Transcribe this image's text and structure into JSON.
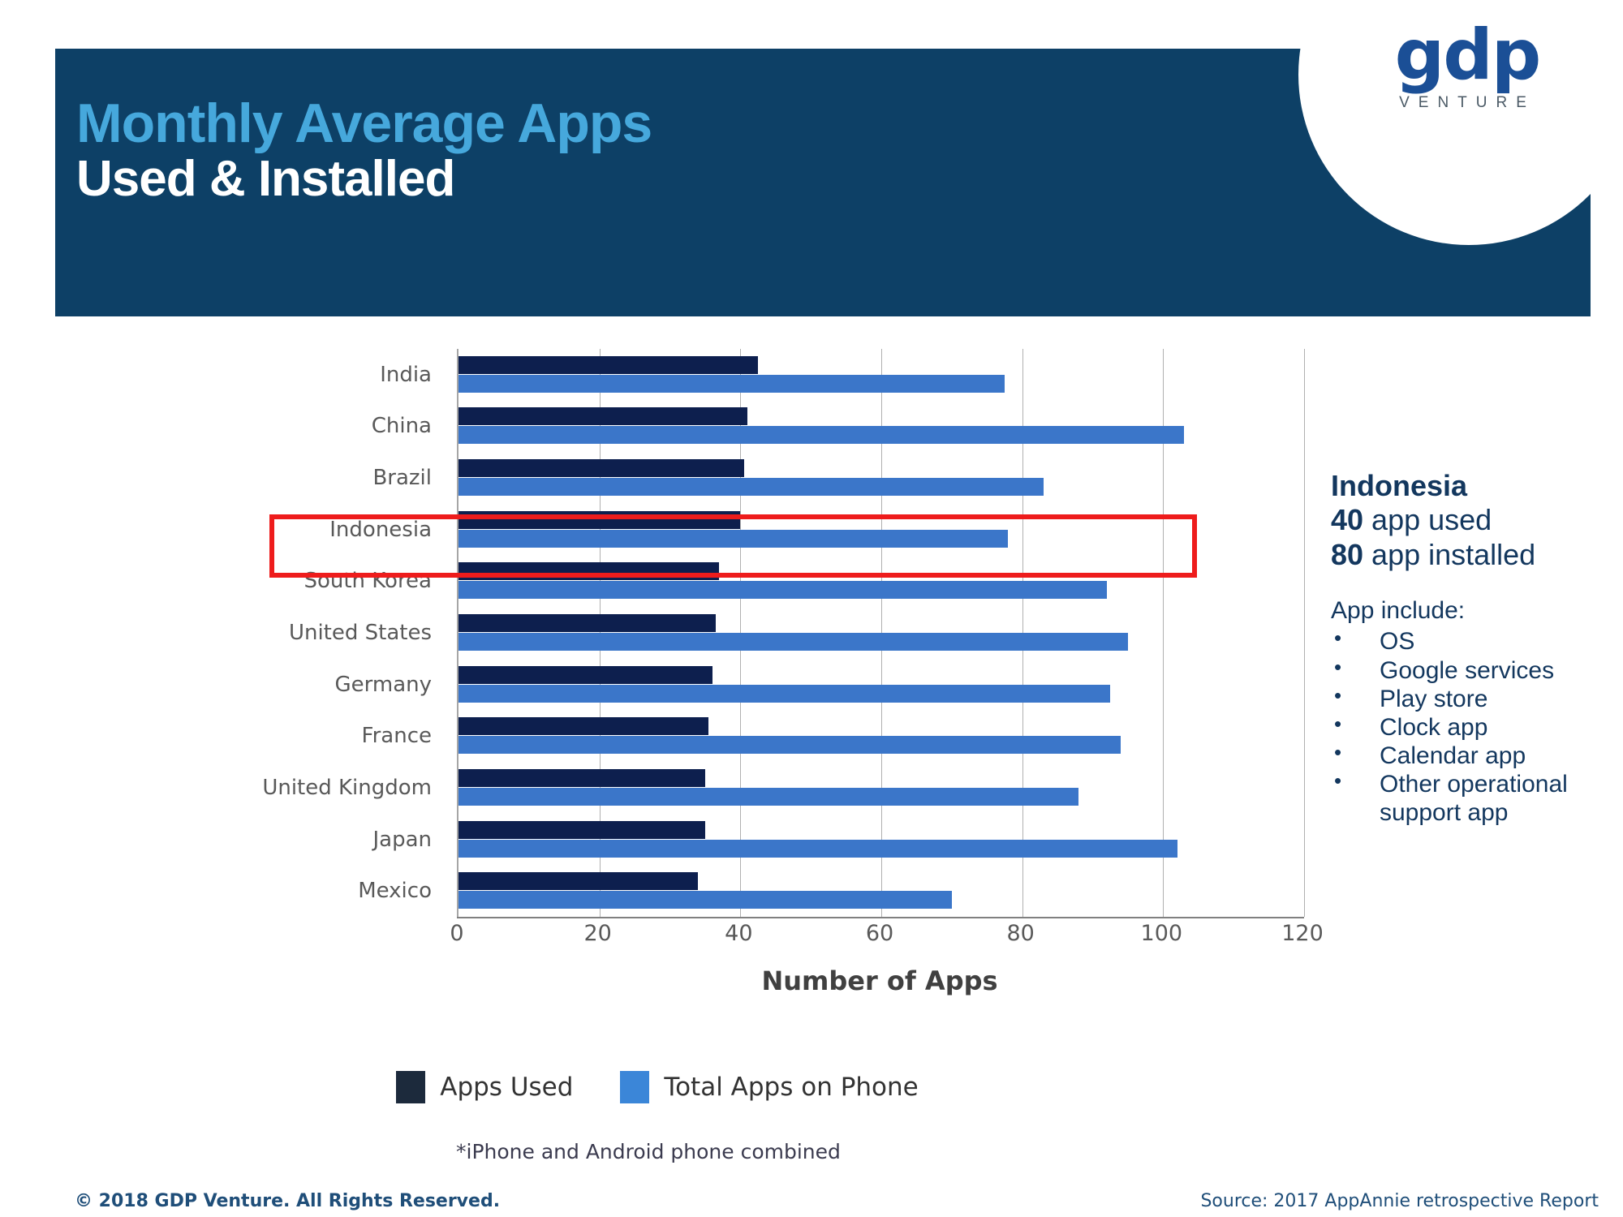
{
  "header": {
    "title_line1": "Monthly Average Apps",
    "title_line2": "Used & Installed",
    "logo_mark": "gdp",
    "logo_sub": "VENTURE",
    "banner_color": "#0d4066",
    "accent_color": "#46a8dc"
  },
  "chart_data": {
    "type": "bar",
    "orientation": "horizontal",
    "title": "",
    "xlabel": "Number of Apps",
    "ylabel": "",
    "xlim": [
      0,
      120
    ],
    "xticks": [
      0,
      20,
      40,
      60,
      80,
      100,
      120
    ],
    "grid": true,
    "legend_position": "bottom",
    "categories": [
      "India",
      "China",
      "Brazil",
      "Indonesia",
      "South Korea",
      "United States",
      "Germany",
      "France",
      "United Kingdom",
      "Japan",
      "Mexico"
    ],
    "series": [
      {
        "name": "Apps Used",
        "color": "#0d1f4e",
        "values": [
          42.5,
          41,
          40.5,
          40,
          37,
          36.5,
          36,
          35.5,
          35,
          35,
          34
        ]
      },
      {
        "name": "Total Apps on Phone",
        "color": "#3b76c9",
        "values": [
          77.5,
          103,
          83,
          78,
          92,
          95,
          92.5,
          94,
          88,
          102,
          70
        ]
      }
    ],
    "footnote": "*iPhone and Android phone combined",
    "highlight": {
      "category": "Indonesia",
      "color": "#ee1c1c"
    }
  },
  "legend": {
    "items": [
      {
        "label": "Apps Used",
        "color": "#1c2a3c"
      },
      {
        "label": "Total Apps on Phone",
        "color": "#3b86d8"
      }
    ]
  },
  "side_panel": {
    "country": "Indonesia",
    "used_value": "40",
    "used_text": " app used",
    "installed_value": "80",
    "installed_text": " app installed",
    "include_heading": "App include:",
    "bullet_glyph": "•",
    "bullets": [
      "OS",
      "Google services",
      "Play store",
      "Clock app",
      "Calendar app",
      "Other operational support app"
    ]
  },
  "footer": {
    "copyright": "© 2018 GDP Venture. All Rights Reserved.",
    "source": "Source: 2017 AppAnnie retrospective Report"
  }
}
